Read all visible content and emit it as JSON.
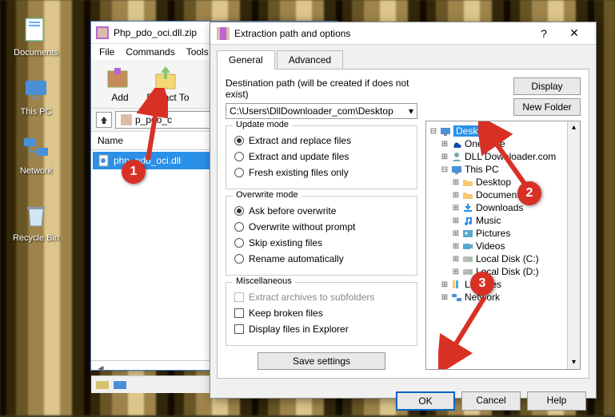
{
  "desktop": {
    "icons": [
      {
        "label": "Documents"
      },
      {
        "label": "This PC"
      },
      {
        "label": "Network"
      },
      {
        "label": "Recycle Bin"
      }
    ]
  },
  "winrar": {
    "title": "Php_pdo_oci.dll.zip",
    "menu": [
      "File",
      "Commands",
      "Tools"
    ],
    "toolbar": [
      {
        "label": "Add"
      },
      {
        "label": "Extract To"
      }
    ],
    "path_entry": "p_pdo_c",
    "columns": {
      "name": "Name"
    },
    "files": [
      {
        "name": "php_pdo_oci.dll",
        "selected": true
      }
    ]
  },
  "dialog": {
    "title": "Extraction path and options",
    "tabs": {
      "general": "General",
      "advanced": "Advanced"
    },
    "dest": {
      "label": "Destination path (will be created if does not exist)",
      "value": "C:\\Users\\DllDownloader_com\\Desktop"
    },
    "update_mode": {
      "title": "Update mode",
      "opts": [
        "Extract and replace files",
        "Extract and update files",
        "Fresh existing files only"
      ],
      "selected": 0
    },
    "overwrite_mode": {
      "title": "Overwrite mode",
      "opts": [
        "Ask before overwrite",
        "Overwrite without prompt",
        "Skip existing files",
        "Rename automatically"
      ],
      "selected": 0
    },
    "misc": {
      "title": "Miscellaneous",
      "opts": [
        "Extract archives to subfolders",
        "Keep broken files",
        "Display files in Explorer"
      ]
    },
    "save_settings": "Save settings",
    "side": {
      "display": "Display",
      "new_folder": "New Folder"
    },
    "tree": [
      {
        "label": "Desktop",
        "indent": 0,
        "exp": "-",
        "sel": true,
        "icon": "desktop"
      },
      {
        "label": "OneDrive",
        "indent": 1,
        "exp": "+",
        "icon": "cloud"
      },
      {
        "label": "DLL Downloader.com",
        "indent": 1,
        "exp": "+",
        "icon": "user"
      },
      {
        "label": "This PC",
        "indent": 1,
        "exp": "-",
        "icon": "pc"
      },
      {
        "label": "Desktop",
        "indent": 2,
        "exp": "+",
        "icon": "folder"
      },
      {
        "label": "Documents",
        "indent": 2,
        "exp": "+",
        "icon": "folder"
      },
      {
        "label": "Downloads",
        "indent": 2,
        "exp": "+",
        "icon": "download"
      },
      {
        "label": "Music",
        "indent": 2,
        "exp": "+",
        "icon": "music"
      },
      {
        "label": "Pictures",
        "indent": 2,
        "exp": "+",
        "icon": "pictures"
      },
      {
        "label": "Videos",
        "indent": 2,
        "exp": "+",
        "icon": "videos"
      },
      {
        "label": "Local Disk (C:)",
        "indent": 2,
        "exp": "+",
        "icon": "disk"
      },
      {
        "label": "Local Disk (D:)",
        "indent": 2,
        "exp": "+",
        "icon": "disk"
      },
      {
        "label": "Libraries",
        "indent": 1,
        "exp": "+",
        "icon": "lib"
      },
      {
        "label": "Network",
        "indent": 1,
        "exp": "+",
        "icon": "net"
      }
    ],
    "buttons": {
      "ok": "OK",
      "cancel": "Cancel",
      "help": "Help"
    }
  },
  "callouts": {
    "c1": "1",
    "c2": "2",
    "c3": "3"
  }
}
